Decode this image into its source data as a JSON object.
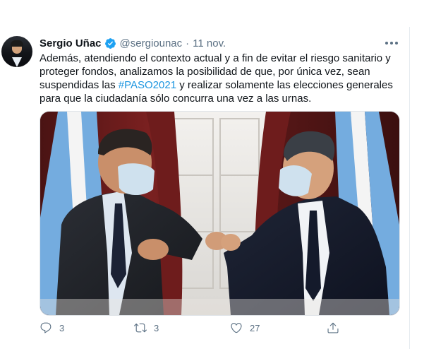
{
  "tweet": {
    "author_name": "Sergio Uñac",
    "handle": "@sergiounac",
    "separator": "·",
    "date": "11 nov.",
    "text_before": "Además, atendiendo el contexto actual y a fin de evitar el riesgo sanitario y proteger fondos, analizamos la posibilidad de que, por única vez, sean suspendidas las ",
    "hashtag": "#PASO2021",
    "text_after": " y realizar solamente las elecciones generales para que la ciudadanía sólo concurra una vez a las urnas.",
    "icons": {
      "verified": "verified-badge-icon",
      "more": "more-options-icon",
      "reply": "reply-icon",
      "retweet": "retweet-icon",
      "like": "like-icon",
      "share": "share-icon"
    },
    "actions": {
      "reply_count": "3",
      "retweet_count": "3",
      "like_count": "27"
    },
    "colors": {
      "link": "#1b95e0",
      "verified": "#1da1f2",
      "secondary_text": "#5b7083"
    }
  }
}
